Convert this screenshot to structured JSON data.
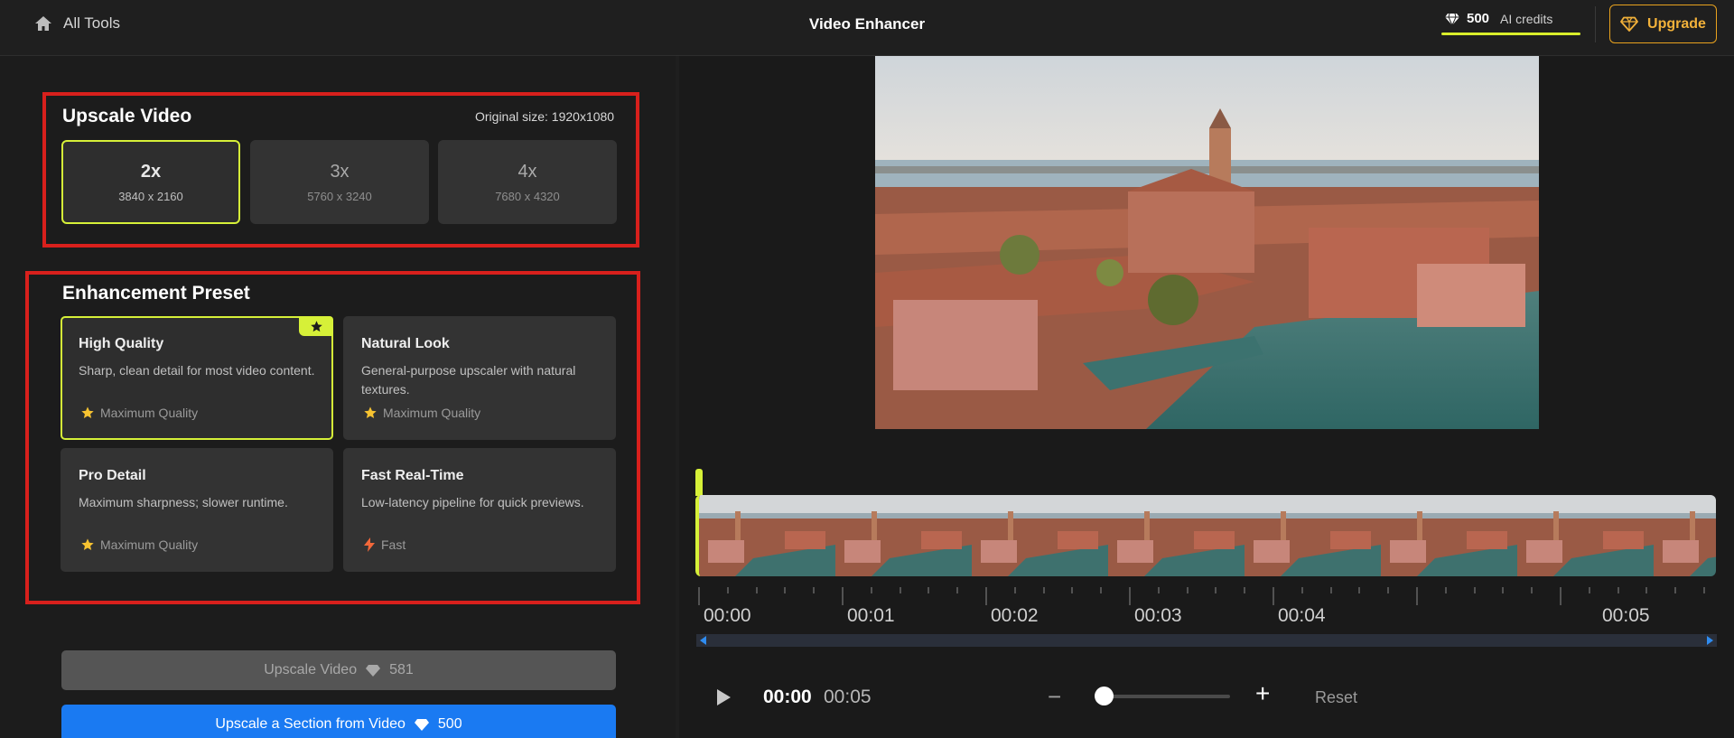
{
  "header": {
    "all_tools_label": "All Tools",
    "title": "Video Enhancer",
    "credits_value": "500",
    "credits_label": "AI credits",
    "upgrade_label": "Upgrade",
    "accent_color": "#d6f038",
    "upgrade_color": "#f2b13a"
  },
  "upscale": {
    "title": "Upscale Video",
    "original_size": "Original size: 1920x1080",
    "options": [
      {
        "factor": "2x",
        "resolution": "3840 x 2160",
        "selected": true
      },
      {
        "factor": "3x",
        "resolution": "5760 x 3240",
        "selected": false
      },
      {
        "factor": "4x",
        "resolution": "7680 x 4320",
        "selected": false
      }
    ]
  },
  "preset": {
    "title": "Enhancement Preset",
    "options": [
      {
        "name": "High Quality",
        "description": "Sharp, clean detail for most video content.",
        "tag": "Maximum Quality",
        "tag_icon": "star-icon",
        "selected": true,
        "recommended": true
      },
      {
        "name": "Natural Look",
        "description": "General-purpose upscaler with natural textures.",
        "tag": "Maximum Quality",
        "tag_icon": "star-icon",
        "selected": false
      },
      {
        "name": "Pro Detail",
        "description": "Maximum sharpness; slower runtime.",
        "tag": "Maximum Quality",
        "tag_icon": "star-icon",
        "selected": false
      },
      {
        "name": "Fast Real-Time",
        "description": "Low-latency pipeline for quick previews.",
        "tag": "Fast",
        "tag_icon": "bolt-icon",
        "selected": false
      }
    ]
  },
  "actions": {
    "upscale_label": "Upscale Video",
    "upscale_cost": "581",
    "section_label": "Upscale a Section from Video",
    "section_cost": "500"
  },
  "timeline": {
    "labels": [
      "00:00",
      "00:01",
      "00:02",
      "00:03",
      "00:04",
      "00:05"
    ],
    "current_time": "00:00",
    "duration": "00:05",
    "reset_label": "Reset"
  }
}
